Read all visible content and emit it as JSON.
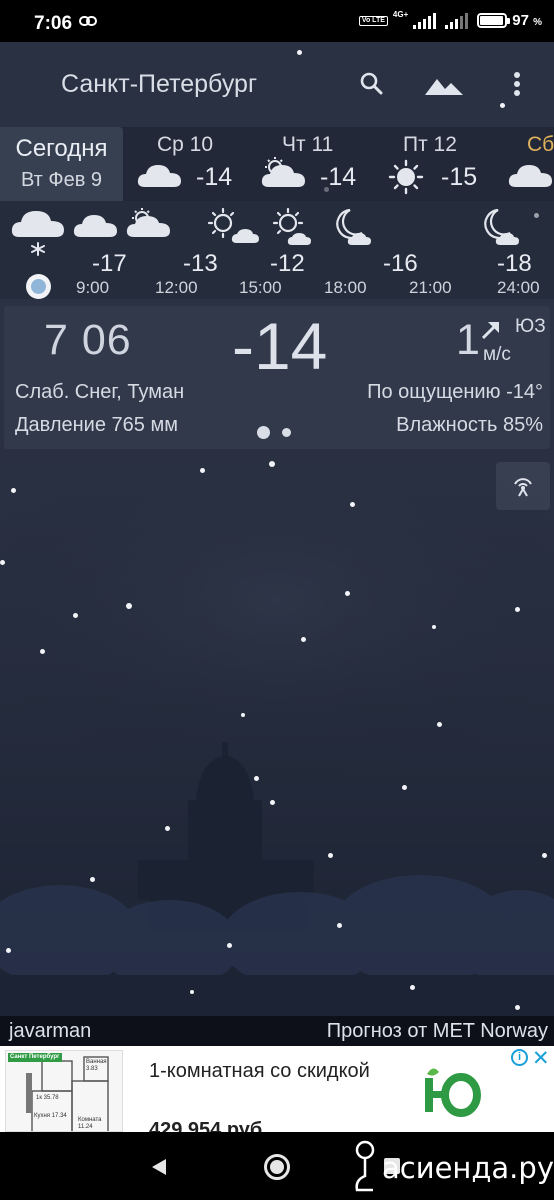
{
  "status_bar": {
    "time": "7:06",
    "network": "4G+",
    "volte": "Vo LTE",
    "battery_percent": "97",
    "battery_unit": "%",
    "battery_level": 0.97
  },
  "app_bar": {
    "city": "Санкт-Петербург",
    "icons": [
      "search-icon",
      "landscape-icon",
      "more-vert-icon"
    ]
  },
  "days": {
    "today": {
      "label": "Сегодня",
      "date": "Вт Фев 9"
    },
    "forecast": [
      {
        "name": "Ср 10",
        "temp": "-14",
        "icon": "cloud-icon"
      },
      {
        "name": "Чт 11",
        "temp": "-14",
        "icon": "partly-cloudy-icon"
      },
      {
        "name": "Пт 12",
        "temp": "-15",
        "icon": "sun-icon"
      },
      {
        "name": "Сб",
        "temp": "",
        "icon": "cloud-icon"
      }
    ]
  },
  "hourly": [
    {
      "temp": "-17",
      "time": "9:00",
      "icon": "partly-cloudy-day-icon"
    },
    {
      "temp": "-13",
      "time": "12:00",
      "icon": "partly-cloudy-day-icon"
    },
    {
      "temp": "-12",
      "time": "15:00",
      "icon": "sun-cloud-icon"
    },
    {
      "temp": "-16",
      "time": "18:00",
      "icon": "moon-cloud-icon"
    },
    {
      "temp": "-18",
      "time": "21:00",
      "icon": "moon-cloud-icon"
    },
    {
      "temp": "",
      "time": "24:00",
      "icon": "moon-cloud-icon"
    }
  ],
  "current": {
    "time": "7 06",
    "temp": "-14",
    "wind_speed": "1",
    "wind_dir": "ЮЗ",
    "wind_unit": "м/с",
    "condition": "Слаб. Снег, Туман",
    "feels_like": "По ощущению -14°",
    "pressure": "Давление 765 мм",
    "humidity": "Влажность 85%"
  },
  "colors": {
    "background": "#2a3142",
    "panel": "#343c4e",
    "accent": "#8fb5d8",
    "saturday": "#e0b25c"
  },
  "credits": {
    "author": "javarman",
    "source": "Прогноз от MET Norway"
  },
  "ad": {
    "badge": "Санкт Петербург",
    "text": "1-комнатная со скидкой",
    "price": "429 954 руб",
    "info": "i",
    "close": "✕",
    "logo_letter": "Ю",
    "plan_labels": [
      "Кухня 17.34",
      "Комната 11.24",
      "Ванная 3.83",
      "1к 35.78"
    ]
  },
  "watermark": "асиенда.ру"
}
